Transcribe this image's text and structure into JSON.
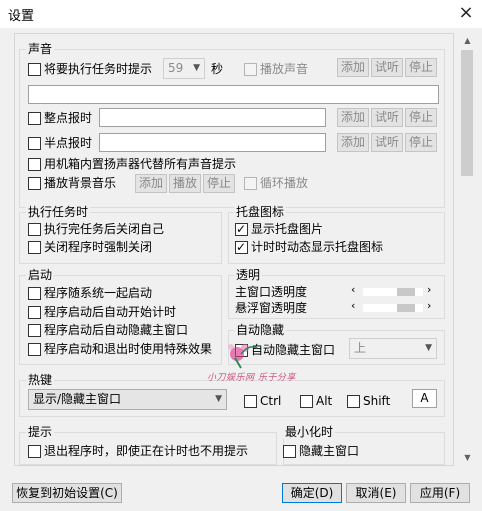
{
  "window": {
    "title": "设置",
    "close_icon": "×"
  },
  "sound": {
    "title": "声音",
    "prompt_label": "将要执行任务时提示",
    "seconds_value": "59",
    "seconds_unit": "秒",
    "play_sound_label": "播放声音",
    "btn_add": "添加",
    "btn_listen": "试听",
    "btn_stop": "停止",
    "hour_label": "整点报时",
    "half_hour_label": "半点报时",
    "speaker_label": "用机箱内置扬声器代替所有声音提示",
    "bg_music_label": "播放背景音乐",
    "btn_play": "播放",
    "loop_label": "循环播放"
  },
  "task": {
    "title": "执行任务时",
    "close_self_label": "执行完任务后关闭自己",
    "force_close_label": "关闭程序时强制关闭"
  },
  "tray": {
    "title": "托盘图标",
    "show_icon_label": "显示托盘图片",
    "dynamic_label": "计时时动态显示托盘图标",
    "show_icon_checked": true,
    "dynamic_checked": true
  },
  "startup": {
    "title": "启动",
    "items": [
      "程序随系统一起启动",
      "程序启动后自动开始计时",
      "程序启动后自动隐藏主窗口",
      "程序启动和退出时使用特殊效果"
    ]
  },
  "transparency": {
    "title": "透明",
    "main_label": "主窗口透明度",
    "float_label": "悬浮窗透明度",
    "main_level": 0.82,
    "float_level": 0.82
  },
  "autohide": {
    "title": "自动隐藏",
    "label": "自动隐藏主窗口",
    "position_value": "上"
  },
  "hotkey": {
    "title": "热键",
    "action_value": "显示/隐藏主窗口",
    "ctrl_label": "Ctrl",
    "alt_label": "Alt",
    "shift_label": "Shift",
    "key_value": "A"
  },
  "tip": {
    "title": "提示",
    "label": "退出程序时，即使正在计时也不用提示"
  },
  "minimize": {
    "title": "最小化时",
    "label": "隐藏主窗口"
  },
  "watermark": {
    "text": "小刀娱乐网 乐于分享"
  },
  "footer": {
    "reset": "恢复到初始设置(C)",
    "ok": "确定(D)",
    "cancel": "取消(E)",
    "apply": "应用(F)"
  }
}
